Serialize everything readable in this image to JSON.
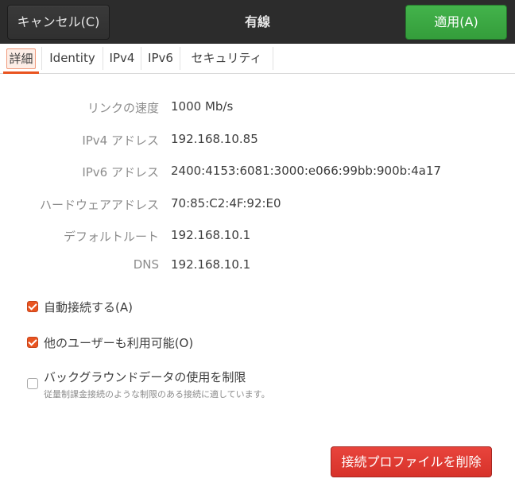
{
  "header": {
    "cancel_label": "キャンセル(C)",
    "title": "有線",
    "apply_label": "適用(A)"
  },
  "tabs": [
    {
      "label": "詳細",
      "active": true
    },
    {
      "label": "Identity",
      "active": false
    },
    {
      "label": "IPv4",
      "active": false
    },
    {
      "label": "IPv6",
      "active": false
    },
    {
      "label": "セキュリティ",
      "active": false
    }
  ],
  "details": [
    {
      "label": "リンクの速度",
      "value": "1000 Mb/s"
    },
    {
      "label": "IPv4 アドレス",
      "value": "192.168.10.85"
    },
    {
      "label": "IPv6 アドレス",
      "value": "2400:4153:6081:3000:e066:99bb:900b:4a17"
    },
    {
      "label": "ハードウェアアドレス",
      "value": "70:85:C2:4F:92:E0"
    },
    {
      "label": "デフォルトルート",
      "value": "192.168.10.1"
    },
    {
      "label": "DNS",
      "value": "192.168.10.1"
    }
  ],
  "options": [
    {
      "label": "自動接続する(A)",
      "checked": true
    },
    {
      "label": "他のユーザーも利用可能(O)",
      "checked": true
    },
    {
      "label": "バックグラウンドデータの使用を制限",
      "checked": false,
      "sublabel": "従量制課金接続のような制限のある接続に適しています。"
    }
  ],
  "delete_label": "接続プロファイルを削除",
  "colors": {
    "accent": "#e95420",
    "apply_green": "#3aa641",
    "delete_red": "#df3b33",
    "header_bg": "#2c2c2c"
  }
}
